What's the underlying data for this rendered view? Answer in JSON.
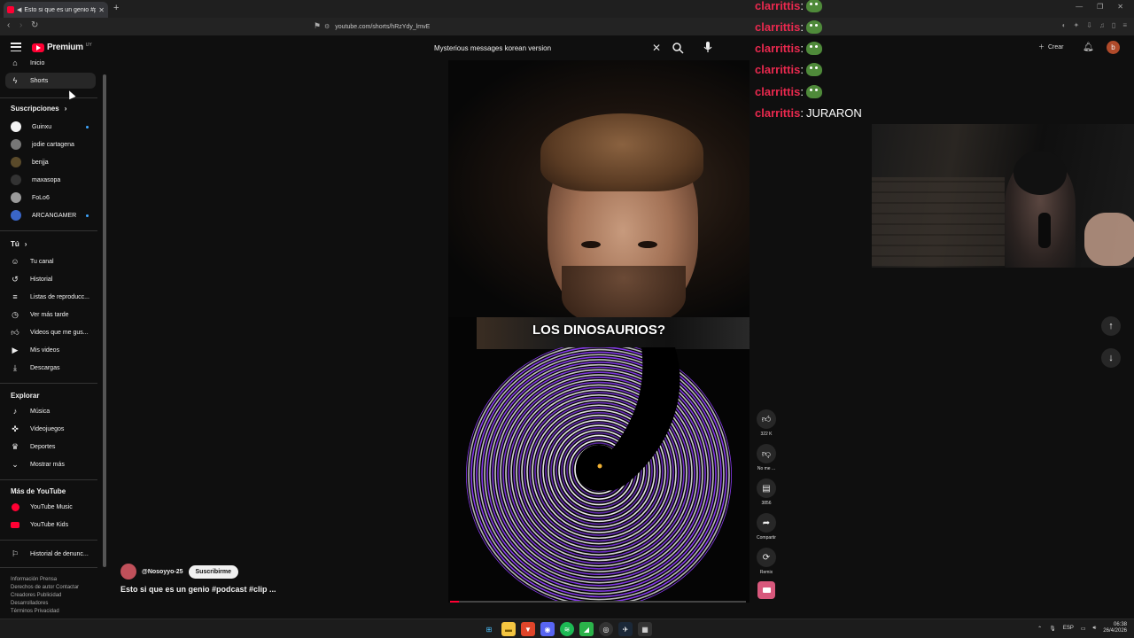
{
  "browser": {
    "tab_title": "Esto si que es un genio #pod",
    "new_tab": "+",
    "url": "youtube.com/shorts/hRzYdy_lmvE"
  },
  "header": {
    "logo_text": "Premium",
    "logo_country": "UY",
    "search_query": "Mysterious messages korean version",
    "create_label": "Crear",
    "avatar_letter": "b"
  },
  "sidebar": {
    "main_items": [
      {
        "label": "Inicio",
        "icon": "home-icon"
      },
      {
        "label": "Shorts",
        "icon": "shorts-icon"
      }
    ],
    "subscriptions_heading": "Suscripciones",
    "subscriptions": [
      {
        "label": "Guinxu",
        "color": "#f3f3f3",
        "dot": true
      },
      {
        "label": "jodie cartagena",
        "color": "#777777",
        "dot": false
      },
      {
        "label": "benjja",
        "color": "#5a4a2a",
        "dot": false
      },
      {
        "label": "maxasopa",
        "color": "#333333",
        "dot": false
      },
      {
        "label": "FoLo6",
        "color": "#9a9a9a",
        "dot": false
      },
      {
        "label": "ARCANGAMER",
        "color": "#3a66c8",
        "dot": true
      }
    ],
    "you_heading": "Tú",
    "you_items": [
      {
        "label": "Tu canal",
        "icon": "channel-icon"
      },
      {
        "label": "Historial",
        "icon": "history-icon"
      },
      {
        "label": "Listas de reproducc...",
        "icon": "playlist-icon"
      },
      {
        "label": "Ver más tarde",
        "icon": "clock-icon"
      },
      {
        "label": "Videos que me gus...",
        "icon": "like-icon"
      },
      {
        "label": "Mis videos",
        "icon": "video-icon"
      },
      {
        "label": "Descargas",
        "icon": "download-icon"
      }
    ],
    "explore_heading": "Explorar",
    "explore_items": [
      {
        "label": "Música",
        "icon": "music-icon"
      },
      {
        "label": "Videojuegos",
        "icon": "gaming-icon"
      },
      {
        "label": "Deportes",
        "icon": "trophy-icon"
      },
      {
        "label": "Mostrar más",
        "icon": "chevron-down-icon"
      }
    ],
    "more_heading": "Más de YouTube",
    "more_items": [
      {
        "label": "YouTube Music",
        "icon": "yt-music-icon"
      },
      {
        "label": "YouTube Kids",
        "icon": "yt-kids-icon"
      }
    ],
    "report_item": "Historial de denunc...",
    "footer_lines": [
      "Información  Prensa",
      "Derechos de autor  Contactar",
      "Creadores  Publicidad",
      "Desarrolladores",
      "Términos  Privacidad"
    ]
  },
  "short": {
    "caption": "LOS DINOSAURIOS?",
    "channel": "@Nosoyyo-25",
    "subscribe": "Suscribirme",
    "title": "Esto si que es un genio #podcast #clip ...",
    "progress": 0.03,
    "likes": "322 K",
    "dislike_label": "No me ...",
    "comments": "3856",
    "share_label": "Compartir",
    "remix_label": "Remix",
    "illusion_color": "#8a3cf0"
  },
  "chat": {
    "lines": [
      {
        "user": "clarrittis",
        "emote": true,
        "msg": ""
      },
      {
        "user": "clarrittis",
        "emote": true,
        "msg": ""
      },
      {
        "user": "clarrittis",
        "emote": true,
        "msg": ""
      },
      {
        "user": "clarrittis",
        "emote": true,
        "msg": ""
      },
      {
        "user": "clarrittis",
        "emote": true,
        "msg": ""
      },
      {
        "user": "clarrittis",
        "emote": false,
        "msg": "JURARON"
      }
    ]
  },
  "taskbar": {
    "lang": "ESP",
    "time": "06:38",
    "date": "26/4/2026"
  }
}
